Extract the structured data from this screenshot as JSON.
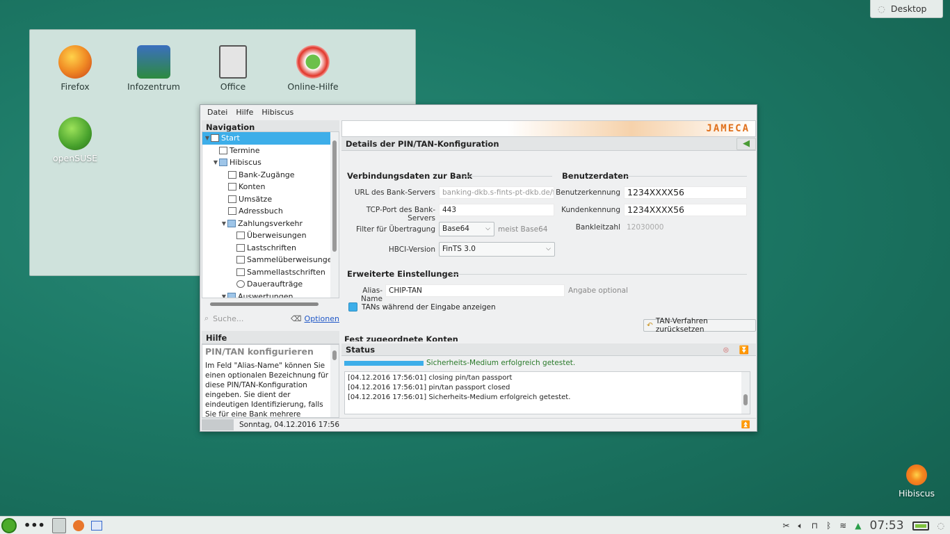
{
  "desktop": {
    "button": "Desktop",
    "folder_icons": [
      {
        "label": "Firefox",
        "color": "#e8762b"
      },
      {
        "label": "Infozentrum",
        "color": "#3b6fbf"
      },
      {
        "label": "Office",
        "color": "#dcdcdc"
      },
      {
        "label": "Online-Hilfe",
        "color": "#e1352a"
      }
    ],
    "opensuse_label": "openSUSE",
    "hibiscus_label": "Hibiscus"
  },
  "window": {
    "menu": [
      "Datei",
      "Hilfe",
      "Hibiscus"
    ],
    "navigation_title": "Navigation",
    "tree": [
      {
        "label": "Start",
        "level": 0,
        "selected": true
      },
      {
        "label": "Termine",
        "level": 1
      },
      {
        "label": "Hibiscus",
        "level": 1,
        "folder": true
      },
      {
        "label": "Bank-Zugänge",
        "level": 2
      },
      {
        "label": "Konten",
        "level": 2
      },
      {
        "label": "Umsätze",
        "level": 2
      },
      {
        "label": "Adressbuch",
        "level": 2
      },
      {
        "label": "Zahlungsverkehr",
        "level": 2,
        "folder": true
      },
      {
        "label": "Überweisungen",
        "level": 3
      },
      {
        "label": "Lastschriften",
        "level": 3
      },
      {
        "label": "Sammelüberweisungen",
        "level": 3
      },
      {
        "label": "Sammellastschriften",
        "level": 3
      },
      {
        "label": "Daueraufträge",
        "level": 3
      },
      {
        "label": "Auswertungen",
        "level": 2,
        "folder": true
      }
    ],
    "search_placeholder": "Suche...",
    "options_link": "Optionen",
    "help_title": "Hilfe",
    "help_heading": "PIN/TAN konfigurieren",
    "help_text": "Im Feld \"Alias-Name\" können Sie einen optionalen Bezeichnung für diese PIN/TAN-Konfiguration eingeben. Sie dient der eindeutigen Identifizierung, falls Sie für eine Bank mehrere Konfigurationen angelegt",
    "brand": "JAMECA",
    "detail_title": "Details der PIN/TAN-Konfiguration",
    "bank_group": "Verbindungsdaten zur Bank",
    "user_group": "Benutzerdaten",
    "url_label": "URL des Bank-Servers",
    "url_value": "banking-dkb.s-fints-pt-dkb.de/fints",
    "port_label": "TCP-Port des Bank-Servers",
    "port_value": "443",
    "filter_label": "Filter für Übertragung",
    "filter_value": "Base64",
    "filter_hint": "meist Base64",
    "hbci_label": "HBCI-Version",
    "hbci_value": "FinTS 3.0",
    "user_id_label": "Benutzerkennung",
    "user_id_value": "1234XXXX56",
    "customer_label": "Kundenkennung",
    "customer_value": "1234XXXX56",
    "blz_label": "Bankleitzahl",
    "blz_value": "12030000",
    "advanced_group": "Erweiterte Einstellungen",
    "alias_label": "Alias-Name",
    "alias_value": "CHIP-TAN",
    "alias_hint": "Angabe optional",
    "show_tan_label": "TANs während der Eingabe anzeigen",
    "reset_btn": "TAN-Verfahren zurücksetzen",
    "accounts_group": "Fest zugeordnete Konten",
    "status_title": "Status",
    "status_message": "Sicherheits-Medium erfolgreich getestet.",
    "log": [
      "[04.12.2016 17:56:01]   closing pin/tan passport",
      "[04.12.2016 17:56:01]   pin/tan passport closed",
      "[04.12.2016 17:56:01] Sicherheits-Medium erfolgreich getestet."
    ],
    "footer_date": "Sonntag, 04.12.2016 17:56"
  },
  "taskbar": {
    "clock": "07:53"
  }
}
